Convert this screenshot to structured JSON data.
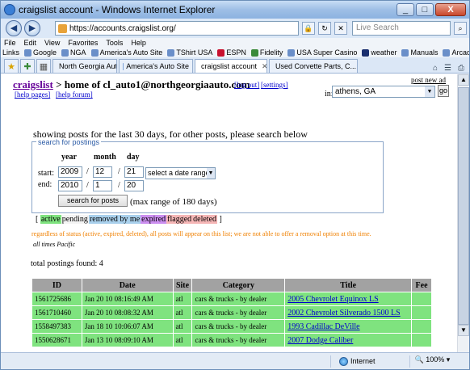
{
  "window": {
    "title": "craigslist account - Windows Internet Explorer",
    "url": "https://accounts.craigslist.org/",
    "live_search_placeholder": "Live Search",
    "minimize": "_",
    "maximize": "□",
    "close": "X"
  },
  "menu": [
    "File",
    "Edit",
    "View",
    "Favorites",
    "Tools",
    "Help"
  ],
  "links_label": "Links",
  "links": [
    "Google",
    "NGA",
    "America's Auto Site",
    "TShirt USA",
    "ESPN",
    "Fidelity",
    "USA Super Casino",
    "weather",
    "Manuals",
    "Arcade"
  ],
  "tabs": [
    {
      "label": "North Georgia Auto"
    },
    {
      "label": "America's Auto Site"
    },
    {
      "label": "craigslist account"
    },
    {
      "label": "Used Corvette Parts, C..."
    }
  ],
  "page": {
    "site_name": "craigslist",
    "home_of": " > home of cl_auto1@northgeorgiaauto.com",
    "log_out": "[log out]",
    "settings": "[settings]",
    "help_pages": "[help pages]",
    "help_forum": "[help forum]",
    "post_new_ad": "post new ad",
    "in_label": "in:",
    "city": "athens, GA",
    "go": "go",
    "showing": "showing posts for the last 30 days, for other posts, please search below"
  },
  "search": {
    "legend": "search for postings",
    "col_year": "year",
    "col_month": "month",
    "col_day": "day",
    "start_label": "start:",
    "end_label": "end:",
    "start_year": "2009",
    "start_month": "12",
    "start_day": "21",
    "end_year": "2010",
    "end_month": "1",
    "end_day": "20",
    "date_range": "select a date range",
    "button": "search for posts",
    "max_range": "(max range of 180 days)"
  },
  "status_legend": {
    "open": "[",
    "active": "active",
    "pending": "pending",
    "removed": "removed by me",
    "expired": "expired",
    "flagged": "flagged",
    "deleted": "deleted",
    "close": "]"
  },
  "warning": "regardless of status (active, expired, deleted), all posts will appear on this list; we are not able to offer a removal option at this time.",
  "times_note": "all times Pacific",
  "total": "total postings found: 4",
  "table": {
    "headers": [
      "ID",
      "Date",
      "Site",
      "Category",
      "Title",
      "Fee"
    ],
    "rows": [
      {
        "id": "1561725686",
        "date": "Jan 20 10 08:16:49 AM",
        "site": "atl",
        "category": "cars & trucks - by dealer",
        "title": "2005 Chevrolet Equinox LS",
        "fee": ""
      },
      {
        "id": "1561710460",
        "date": "Jan 20 10 08:08:32 AM",
        "site": "atl",
        "category": "cars & trucks - by dealer",
        "title": "2002 Chevrolet Silverado 1500 LS",
        "fee": ""
      },
      {
        "id": "1558497383",
        "date": "Jan 18 10 10:06:07 AM",
        "site": "atl",
        "category": "cars & trucks - by dealer",
        "title": "1993 Cadillac DeVille",
        "fee": ""
      },
      {
        "id": "1550628671",
        "date": "Jan 13 10 08:09:10 AM",
        "site": "atl",
        "category": "cars & trucks - by dealer",
        "title": "2007 Dodge Caliber",
        "fee": ""
      }
    ]
  },
  "statusbar": {
    "zone": "Internet",
    "zoom": "100%"
  },
  "colors": {
    "active_row": "#7fe37f",
    "header_row": "#a2a2a2",
    "link": "#0000cc",
    "warning": "#f08000"
  }
}
